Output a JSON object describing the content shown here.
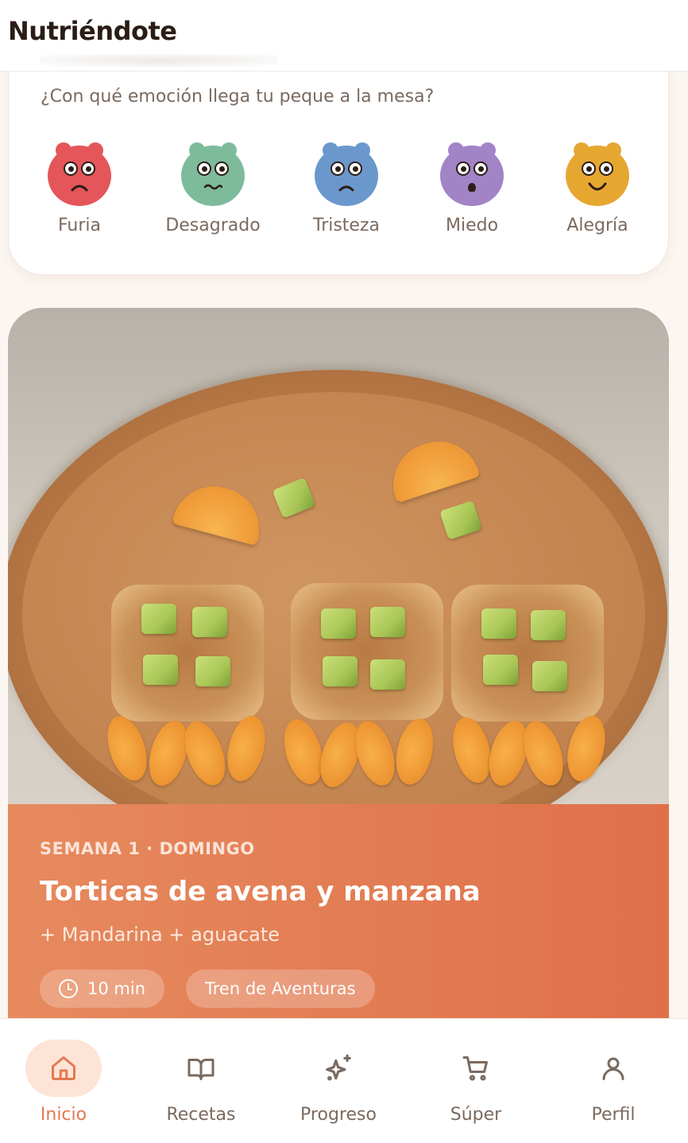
{
  "app": {
    "title": "Nutriéndote"
  },
  "emotions": {
    "question": "¿Con qué emoción llega tu peque a la mesa?",
    "items": [
      {
        "label": "Furia",
        "color": "#e4565a",
        "icon": "angry-face-icon"
      },
      {
        "label": "Desagrado",
        "color": "#7dbb9b",
        "icon": "disgust-face-icon"
      },
      {
        "label": "Tristeza",
        "color": "#6b98cc",
        "icon": "sad-face-icon"
      },
      {
        "label": "Miedo",
        "color": "#a283c6",
        "icon": "fear-face-icon"
      },
      {
        "label": "Alegría",
        "color": "#e6a731",
        "icon": "joy-face-icon"
      }
    ]
  },
  "recipe": {
    "week": "SEMANA 1 · DOMINGO",
    "title": "Torticas de avena y manzana",
    "subtitle": "+ Mandarina + aguacate",
    "time": "10 min",
    "theme": "Tren de Aventuras",
    "accent": "#e0704a"
  },
  "nav": {
    "items": [
      {
        "label": "Inicio",
        "icon": "home-icon",
        "active": true
      },
      {
        "label": "Recetas",
        "icon": "book-icon",
        "active": false
      },
      {
        "label": "Progreso",
        "icon": "sparkles-icon",
        "active": false
      },
      {
        "label": "Súper",
        "icon": "cart-icon",
        "active": false
      },
      {
        "label": "Perfil",
        "icon": "user-icon",
        "active": false
      }
    ]
  }
}
